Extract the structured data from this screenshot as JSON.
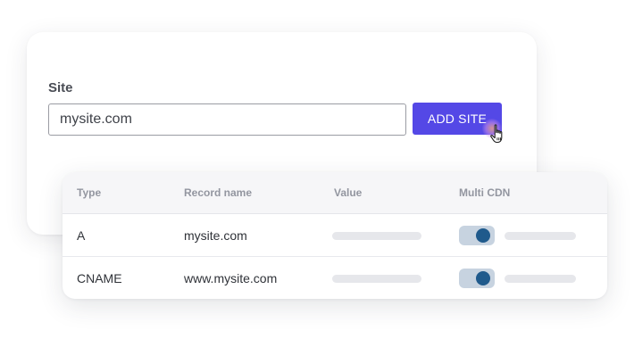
{
  "site_form": {
    "label": "Site",
    "input_value": "mysite.com",
    "add_button_label": "ADD SITE"
  },
  "records_table": {
    "columns": [
      "Type",
      "Record name",
      "Value",
      "Multi CDN"
    ],
    "rows": [
      {
        "type": "A",
        "record_name": "mysite.com",
        "multi_cdn_enabled": true
      },
      {
        "type": "CNAME",
        "record_name": "www.mysite.com",
        "multi_cdn_enabled": true
      }
    ]
  },
  "colors": {
    "accent": "#5448e6",
    "toggle_track": "#c7d3e0",
    "toggle_knob": "#1f5a8c"
  },
  "icons": {
    "cursor": "hand-pointer-icon"
  }
}
